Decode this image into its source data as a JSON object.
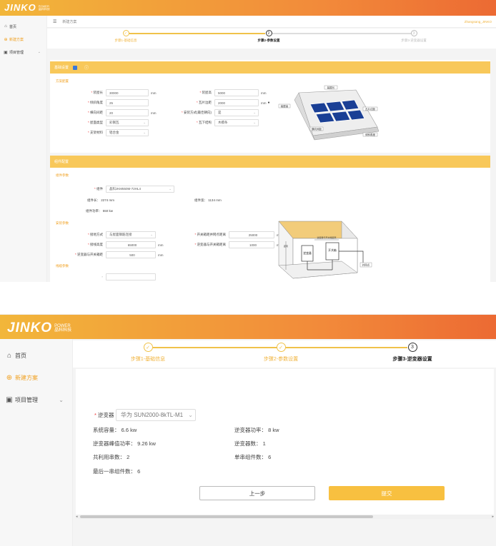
{
  "brand": {
    "logo": "JINKO",
    "logo_sub_top": "POWER",
    "logo_sub_bottom": "晶科科技",
    "accent": "#f8c040"
  },
  "sidebar": {
    "items": [
      {
        "label": "首页",
        "icon": "home-icon"
      },
      {
        "label": "新建方案",
        "icon": "add-circle-icon"
      },
      {
        "label": "项目管理",
        "icon": "folder-icon"
      }
    ]
  },
  "header": {
    "breadcrumb": "新建方案",
    "user": "Zhangsang_JINKO"
  },
  "steps": [
    {
      "num": "1",
      "label": "步骤1-基础信息"
    },
    {
      "num": "2",
      "label": "步骤2-参数设置"
    },
    {
      "num": "3",
      "label": "步骤3-逆变器设置"
    }
  ],
  "params": {
    "section1_title": "基础设置",
    "section1_sub": "方案配置",
    "fields": [
      {
        "label": "装屋长",
        "value": "30000",
        "unit": "mm"
      },
      {
        "label": "装屋高",
        "value": "5000",
        "unit": "mm"
      },
      {
        "label": "倾斜角度",
        "value": "25",
        "unit": ""
      },
      {
        "label": "瓦片边距",
        "value": "2000",
        "unit": "mm"
      },
      {
        "label": "横向间距",
        "value": "20",
        "unit": "mm"
      },
      {
        "label": "安装方式(最佳朝向)",
        "value": "是",
        "unit": ""
      },
      {
        "label": "屋面类型",
        "value": "彩钢瓦",
        "unit": ""
      },
      {
        "label": "瓦下结构",
        "value": "木檩条",
        "unit": ""
      },
      {
        "label": "支架材料",
        "value": "铝合金",
        "unit": ""
      }
    ],
    "roof_labels": [
      "装屋长",
      "装屋高",
      "瓦片边距",
      "横向间距",
      "倾斜角度"
    ],
    "section2_title": "组件配置",
    "section2_sub": "组件参数",
    "module_label": "组件",
    "module_value": "晶科JKM550M-72HL4",
    "module_len_label": "组件长",
    "module_len": "2274 mm",
    "module_wid_label": "组件宽",
    "module_wid": "1134 mm",
    "module_pow_label": "组件功率",
    "module_pow": "550 kw",
    "section3_sub": "安装参数",
    "install_fields": [
      {
        "label": "接地方式",
        "value": "与屋面钢筋连接",
        "unit": ""
      },
      {
        "label": "开关箱距并网点距离",
        "value": "25000",
        "unit": "mm"
      },
      {
        "label": "接线高度",
        "value": "65000",
        "unit": "mm"
      },
      {
        "label": "逆变器与开关箱距离",
        "value": "1000",
        "unit": "mm"
      },
      {
        "label": "逆变器与开关箱距",
        "value": "500",
        "unit": "mm"
      }
    ],
    "section4_sub": "线缆参数",
    "house_labels": [
      "逆变器",
      "开关箱",
      "逆变器与开关箱距离",
      "距离",
      "并网点"
    ]
  },
  "inverter": {
    "label": "逆变器",
    "value": "华为 SUN2000-8kTL-M1",
    "stats": [
      {
        "label": "系统容量",
        "value": "6.6 kw"
      },
      {
        "label": "逆变器功率",
        "value": "8 kw"
      },
      {
        "label": "逆变器峰值功率",
        "value": "9.26 kw"
      },
      {
        "label": "逆变器数",
        "value": "1"
      },
      {
        "label": "共利用串数",
        "value": "2"
      },
      {
        "label": "单串组件数",
        "value": "6"
      },
      {
        "label": "最后一串组件数",
        "value": "6"
      }
    ],
    "prev_label": "上一步",
    "submit_label": "提交"
  }
}
